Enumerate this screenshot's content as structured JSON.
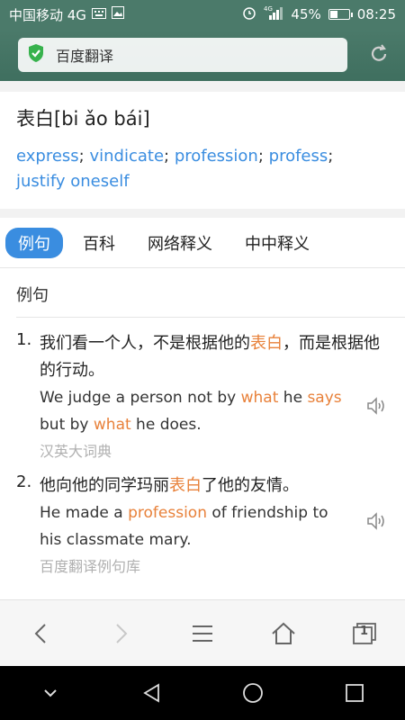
{
  "status": {
    "carrier": "中国移动 4G",
    "network": "4G",
    "battery_percent": "45%",
    "battery_level": 0.45,
    "time": "08:25"
  },
  "browser": {
    "page_title": "百度翻译",
    "security_icon": "shield-check-icon",
    "reload_icon": "reload-icon"
  },
  "word": {
    "headword": "表白[bi ǎo bái]",
    "definitions": [
      "express",
      "vindicate",
      "profession",
      "profess",
      "justify oneself"
    ]
  },
  "tabs": [
    {
      "label": "例句",
      "active": true
    },
    {
      "label": "百科",
      "active": false
    },
    {
      "label": "网络释义",
      "active": false
    },
    {
      "label": "中中释义",
      "active": false
    }
  ],
  "section_title": "例句",
  "examples": [
    {
      "num": "1.",
      "zh_before": "我们看一个人，不是根据他的",
      "zh_hl": "表白",
      "zh_after": "，而是根据他的行动。",
      "en_1": "We judge a person not by ",
      "en_hl1": "what",
      "en_2": " he ",
      "en_hl2": "says",
      "en_3": " but by ",
      "en_hl3": "what",
      "en_4": " he does.",
      "source": "汉英大词典"
    },
    {
      "num": "2.",
      "zh_before": "他向他的同学玛丽",
      "zh_hl": "表白",
      "zh_after": "了他的友情。",
      "en_1": "He made a ",
      "en_hl1": "profession",
      "en_2": " of friendship to his classmate mary.",
      "source": "百度翻译例句库"
    }
  ],
  "bottom_nav": {
    "back": "back-icon",
    "forward": "forward-icon",
    "menu": "menu-icon",
    "home": "home-icon",
    "tabs_count": "1"
  },
  "colors": {
    "accent": "#3a8de0",
    "highlight": "#e8813a",
    "header": "#4b7a6a"
  }
}
